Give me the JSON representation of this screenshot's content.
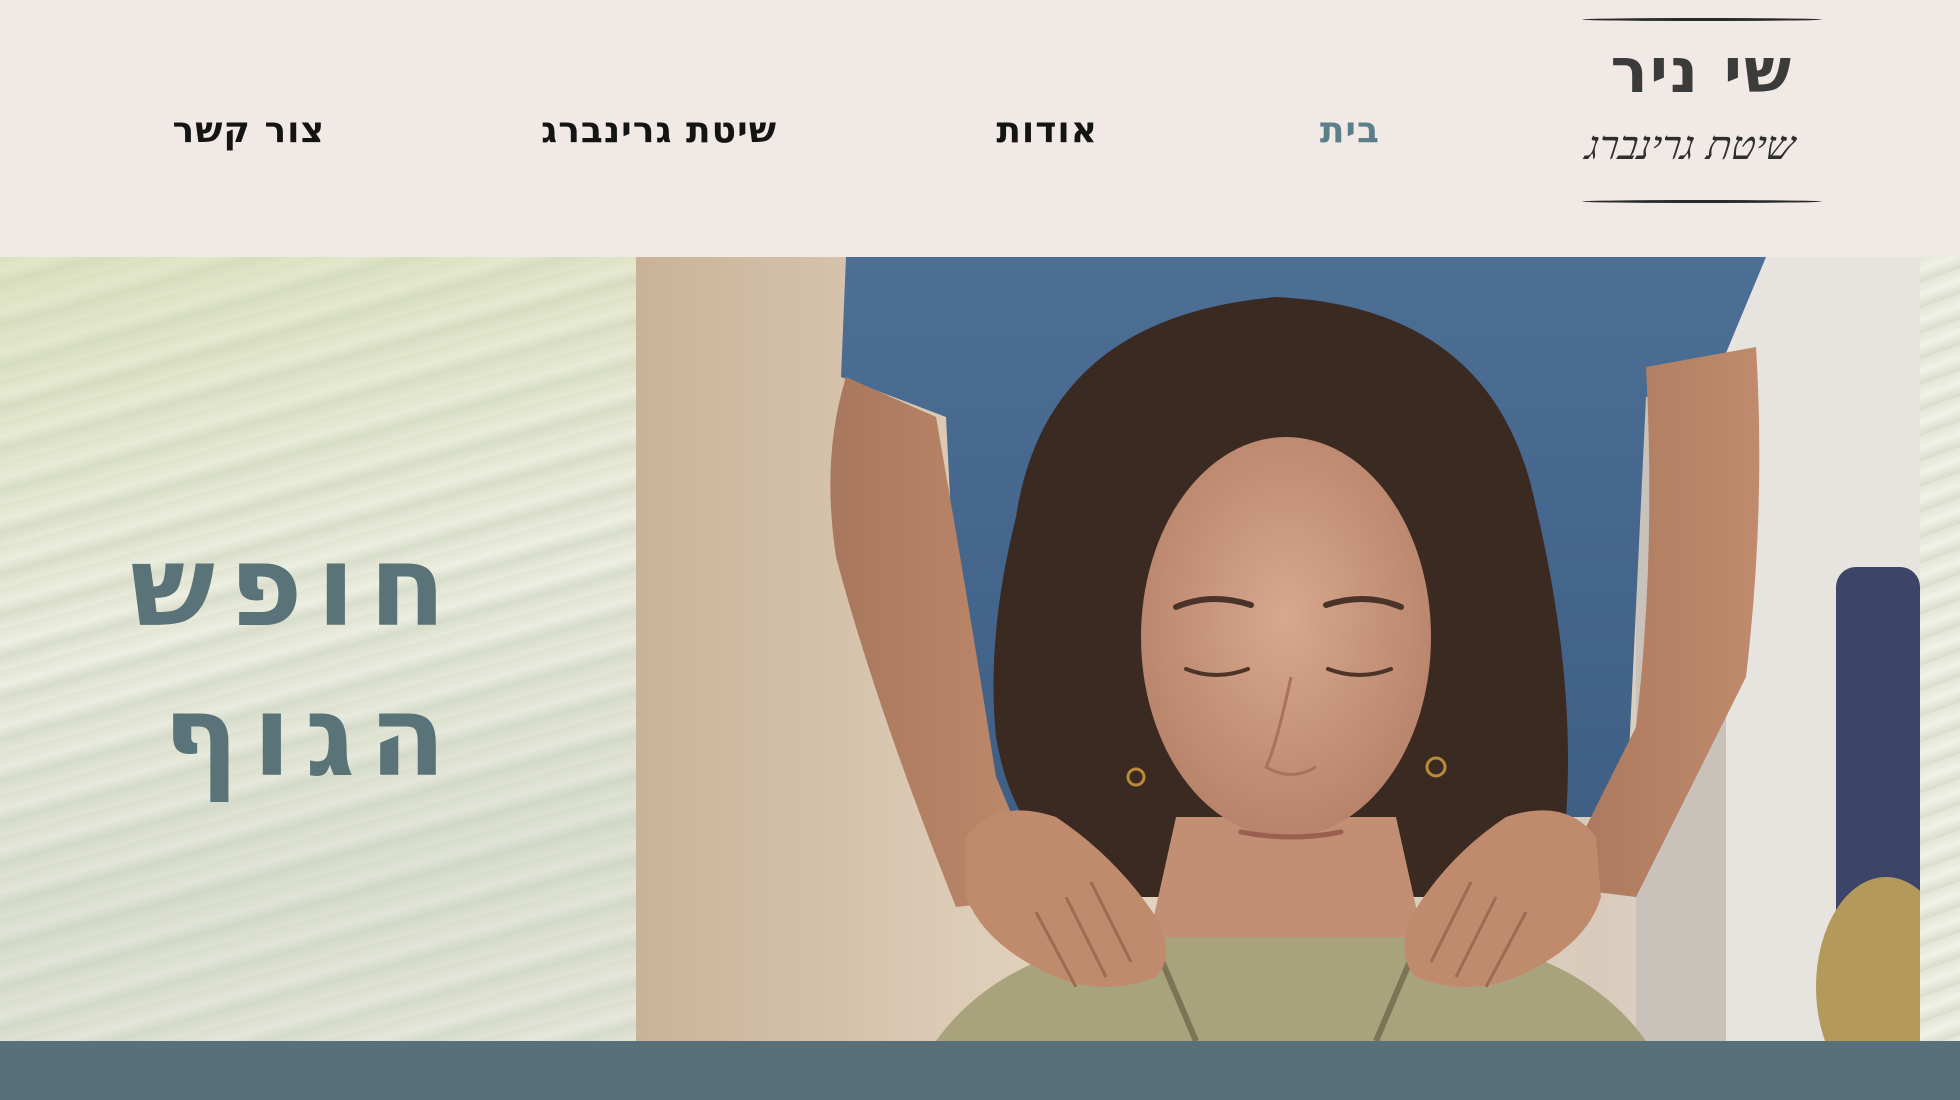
{
  "header": {
    "logo": {
      "name": "שי ניר",
      "tagline": "שיטת גרינברג"
    },
    "nav": [
      {
        "label": "בית",
        "active": true
      },
      {
        "label": "אודות",
        "active": false
      },
      {
        "label": "שיטת גרינברג",
        "active": false
      },
      {
        "label": "צור קשר",
        "active": false
      }
    ]
  },
  "hero": {
    "tagline_line1": "חופש",
    "tagline_line2": "הגוף",
    "image": "photo-hands-on-shoulders"
  },
  "band": {
    "text": "..."
  },
  "colors": {
    "background": "#f1e9e6",
    "accent": "#5b7f8b",
    "hero_text": "#597378",
    "band": "#57707a"
  }
}
